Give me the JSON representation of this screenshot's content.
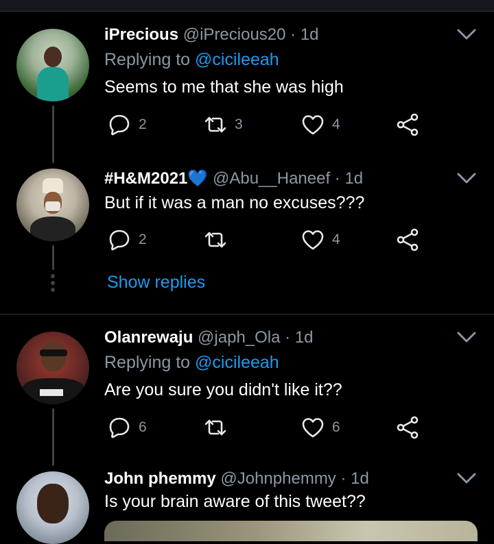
{
  "tweets": [
    {
      "name": "iPrecious",
      "handle": "@iPrecious20",
      "time": "· 1d",
      "replying_prefix": "Replying to",
      "replying_to": "@cicileeah",
      "text": "Seems to me that she was high",
      "replies": "2",
      "retweets": "3",
      "likes": "4"
    },
    {
      "name": "#H&M2021",
      "emoji": "💙",
      "handle": "@Abu__Haneef",
      "time": "· 1d",
      "text": "But if it was a man no excuses???",
      "replies": "2",
      "retweets": "",
      "likes": "4"
    },
    {
      "name": "Olanrewaju",
      "handle": "@japh_Ola",
      "time": "· 1d",
      "replying_prefix": "Replying to",
      "replying_to": "@cicileeah",
      "text": "Are you sure you didn't like it??",
      "replies": "6",
      "retweets": "",
      "likes": "6"
    },
    {
      "name": "John phemmy",
      "handle": "@Johnphemmy",
      "time": "· 1d",
      "text": "Is your brain aware of this tweet??"
    }
  ],
  "show_replies": "Show replies",
  "colors": {
    "background": "#000000",
    "accent": "#1d9bf0",
    "secondary_text": "#8b98a5",
    "heart_emoji": "#5aa9e6"
  },
  "icons": [
    "reply-icon",
    "retweet-icon",
    "like-icon",
    "share-icon",
    "chevron-down-icon",
    "blue-heart-emoji"
  ]
}
